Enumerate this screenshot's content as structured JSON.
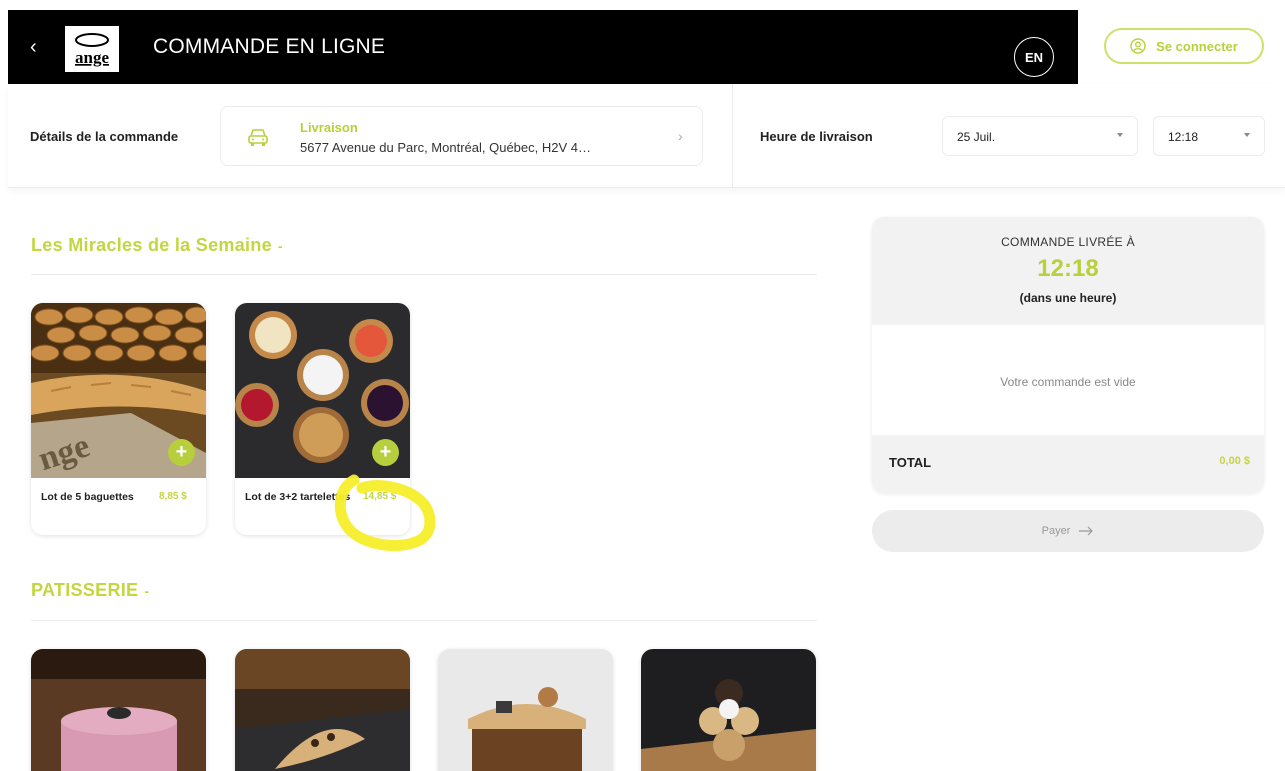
{
  "header": {
    "title": "COMMANDE EN LIGNE",
    "back_icon": "chevron-left-icon",
    "logo_text": "ange",
    "language_button": "EN",
    "login_button": "Se connecter",
    "login_icon": "user-circle-icon"
  },
  "order_details": {
    "label": "Détails de la commande",
    "mode": "Livraison",
    "address": "5677 Avenue du Parc, Montréal, Québec, H2V 4…",
    "mode_icon": "car-icon",
    "time_label": "Heure de livraison",
    "date_value": "25 Juil.",
    "time_value": "12:18"
  },
  "sections": [
    {
      "title": "Les Miracles de la Semaine",
      "toggle": "-",
      "products": [
        {
          "name": "Lot de 5 baguettes",
          "price": "8,85 $",
          "add_icon": "plus-icon"
        },
        {
          "name": "Lot de 3+2 tartelettes",
          "price": "14,85 $",
          "add_icon": "plus-icon"
        }
      ]
    },
    {
      "title": "PATISSERIE",
      "toggle": "-",
      "products_visible": 4
    }
  ],
  "summary": {
    "delivered_label": "COMMANDE LIVRÉE À",
    "delivered_time": "12:18",
    "delivered_sub": "(dans une heure)",
    "empty_message": "Votre commande est vide",
    "total_label": "TOTAL",
    "total_value": "0,00 $",
    "pay_button": "Payer",
    "pay_icon": "arrow-right-icon"
  },
  "colors": {
    "accent": "#c3d63f",
    "header_bg": "#000000",
    "annotation": "#f5ee2a"
  }
}
